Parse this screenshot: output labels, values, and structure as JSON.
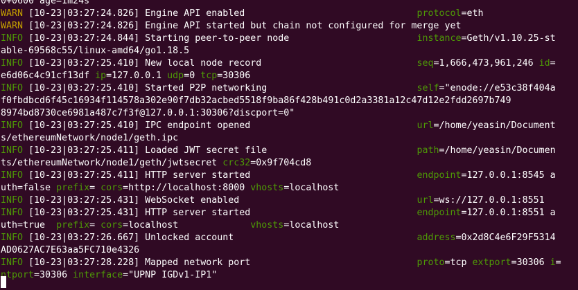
{
  "colors": {
    "background": "#300a24",
    "text": "#ffffff",
    "info": "#4e9a06",
    "warn": "#c4a000",
    "key": "#4e9a06"
  },
  "lines": [
    {
      "text": "0+0600 age=1m24s"
    },
    {
      "level": "WARN",
      "ts": " [10-23|03:27:24.826] ",
      "msg": "Engine API enabled                 ",
      "kv": [
        {
          "k": "protocol",
          "v": "eth"
        }
      ]
    },
    {
      "level": "WARN",
      "ts": " [10-23|03:27:24.826] ",
      "msg": "Engine API started but chain not configured for merge yet"
    },
    {
      "level": "INFO",
      "ts": " [10-23|03:27:24.844] ",
      "msg": "Starting peer-to-peer node         ",
      "kv": [
        {
          "k": "instance",
          "v": "Geth/v1.10.25-st"
        }
      ]
    },
    {
      "text": "able-69568c55/linux-amd64/go1.18.5"
    },
    {
      "level": "INFO",
      "ts": " [10-23|03:27:25.410] ",
      "msg": "New local node record              ",
      "kv": [
        {
          "k": "seq",
          "v": "1,666,473,961,246 "
        },
        {
          "k": "id",
          "v": ""
        }
      ]
    },
    {
      "parts": [
        {
          "t": "e6d06c4c91cf13df ",
          "c": "val"
        },
        {
          "t": "ip",
          "c": "key"
        },
        {
          "t": "=127.0.0.1 ",
          "c": "val"
        },
        {
          "t": "udp",
          "c": "key"
        },
        {
          "t": "=0 ",
          "c": "val"
        },
        {
          "t": "tcp",
          "c": "key"
        },
        {
          "t": "=30306",
          "c": "val"
        }
      ]
    },
    {
      "level": "INFO",
      "ts": " [10-23|03:27:25.410] ",
      "msg": "Started P2P networking             ",
      "kv": [
        {
          "k": "self",
          "v": "\"enode://e53c38f404a"
        }
      ]
    },
    {
      "text": "f0fbdbcd6f45c16934f114578a302e90f7db32acbed5518f9ba86f428b491c0d2a3381a12c47d12e2fdd2697b749"
    },
    {
      "text": "8974bd8730ce6981a487c7f3f@127.0.0.1:30306?discport=0\""
    },
    {
      "level": "INFO",
      "ts": " [10-23|03:27:25.410] ",
      "msg": "IPC endpoint opened                ",
      "kv": [
        {
          "k": "url",
          "v": "/home/yeasin/Document"
        }
      ]
    },
    {
      "text": "s/ethereumNetwork/node1/geth.ipc"
    },
    {
      "level": "INFO",
      "ts": " [10-23|03:27:25.411] ",
      "msg": "Loaded JWT secret file             ",
      "kv": [
        {
          "k": "path",
          "v": "/home/yeasin/Documen"
        }
      ]
    },
    {
      "parts": [
        {
          "t": "ts/ethereumNetwork/node1/geth/jwtsecret ",
          "c": "val"
        },
        {
          "t": "crc32",
          "c": "key"
        },
        {
          "t": "=0x9f704cd8",
          "c": "val"
        }
      ]
    },
    {
      "level": "INFO",
      "ts": " [10-23|03:27:25.411] ",
      "msg": "HTTP server started                ",
      "kv": [
        {
          "k": "endpoint",
          "v": "127.0.0.1:8545 a"
        }
      ]
    },
    {
      "parts": [
        {
          "t": "uth=false ",
          "c": "val"
        },
        {
          "t": "prefix",
          "c": "key"
        },
        {
          "t": "= ",
          "c": "val"
        },
        {
          "t": "cors",
          "c": "key"
        },
        {
          "t": "=http://localhost:8000 ",
          "c": "val"
        },
        {
          "t": "vhosts",
          "c": "key"
        },
        {
          "t": "=localhost",
          "c": "val"
        }
      ]
    },
    {
      "level": "INFO",
      "ts": " [10-23|03:27:25.431] ",
      "msg": "WebSocket enabled                  ",
      "kv": [
        {
          "k": "url",
          "v": "ws://127.0.0.1:8551"
        }
      ]
    },
    {
      "level": "INFO",
      "ts": " [10-23|03:27:25.431] ",
      "msg": "HTTP server started                ",
      "kv": [
        {
          "k": "endpoint",
          "v": "127.0.0.1:8551 a"
        }
      ]
    },
    {
      "parts": [
        {
          "t": "uth=true  ",
          "c": "val"
        },
        {
          "t": "prefix",
          "c": "key"
        },
        {
          "t": "= ",
          "c": "val"
        },
        {
          "t": "cors",
          "c": "key"
        },
        {
          "t": "=localhost             ",
          "c": "val"
        },
        {
          "t": "vhosts",
          "c": "key"
        },
        {
          "t": "=localhost",
          "c": "val"
        }
      ]
    },
    {
      "level": "INFO",
      "ts": " [10-23|03:27:26.667] ",
      "msg": "Unlocked account                   ",
      "kv": [
        {
          "k": "address",
          "v": "0x2d8C4e6F29F5314"
        }
      ]
    },
    {
      "text": "AD0627AC7E63aa5FC710e4326"
    },
    {
      "level": "INFO",
      "ts": " [10-23|03:27:28.228] ",
      "msg": "Mapped network port                ",
      "kv": [
        {
          "k": "proto",
          "v": "tcp "
        },
        {
          "k": "extport",
          "v": "30306 "
        },
        {
          "k": "i",
          "v": ""
        }
      ]
    },
    {
      "parts": [
        {
          "t": "ntport",
          "c": "key"
        },
        {
          "t": "=30306 ",
          "c": "val"
        },
        {
          "t": "interface",
          "c": "key"
        },
        {
          "t": "=\"UPNP IGDv1-IP1\"",
          "c": "val"
        }
      ]
    }
  ]
}
